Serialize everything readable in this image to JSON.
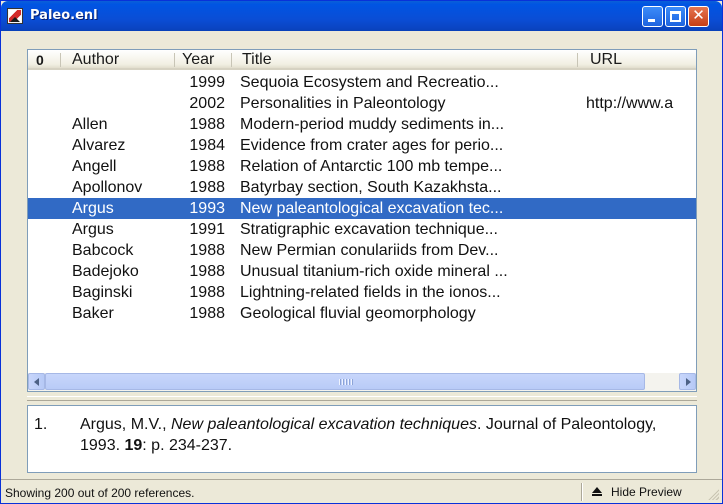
{
  "window": {
    "title": "Paleo.enl"
  },
  "columns": {
    "attachment": "0",
    "author": "Author",
    "year": "Year",
    "title": "Title",
    "url": "URL"
  },
  "rows": [
    {
      "author": "",
      "year": "1999",
      "title": "Sequoia Ecosystem and Recreatio...",
      "url": ""
    },
    {
      "author": "",
      "year": "2002",
      "title": "Personalities in Paleontology",
      "url": "http://www.a"
    },
    {
      "author": "Allen",
      "year": "1988",
      "title": "Modern-period muddy sediments in...",
      "url": ""
    },
    {
      "author": "Alvarez",
      "year": "1984",
      "title": "Evidence from crater ages for perio...",
      "url": ""
    },
    {
      "author": "Angell",
      "year": "1988",
      "title": "Relation of Antarctic 100 mb tempe...",
      "url": ""
    },
    {
      "author": "Apollonov",
      "year": "1988",
      "title": "Batyrbay section, South Kazakhsta...",
      "url": ""
    },
    {
      "author": "Argus",
      "year": "1993",
      "title": "New paleantological excavation tec...",
      "url": "",
      "selected": true
    },
    {
      "author": "Argus",
      "year": "1991",
      "title": "Stratigraphic excavation technique...",
      "url": ""
    },
    {
      "author": "Babcock",
      "year": "1988",
      "title": "New Permian conulariids from Dev...",
      "url": ""
    },
    {
      "author": "Badejoko",
      "year": "1988",
      "title": "Unusual titanium-rich oxide mineral ...",
      "url": ""
    },
    {
      "author": "Baginski",
      "year": "1988",
      "title": "Lightning-related fields in the ionos...",
      "url": ""
    },
    {
      "author": "Baker",
      "year": "1988",
      "title": "Geological fluvial geomorphology",
      "url": ""
    }
  ],
  "preview": {
    "number": "1.",
    "author_part": "Argus, M.V., ",
    "title_part": "New paleantological excavation techniques",
    "journal_part": ". Journal of Paleontology, 1993. ",
    "volume": "19",
    "pages_part": ": p. 234-237."
  },
  "status": {
    "text": "Showing 200 out of 200 references.",
    "hide_preview_label": "Hide Preview"
  },
  "colors": {
    "selection": "#316ac5",
    "titlebar": "#0a4ed6"
  }
}
